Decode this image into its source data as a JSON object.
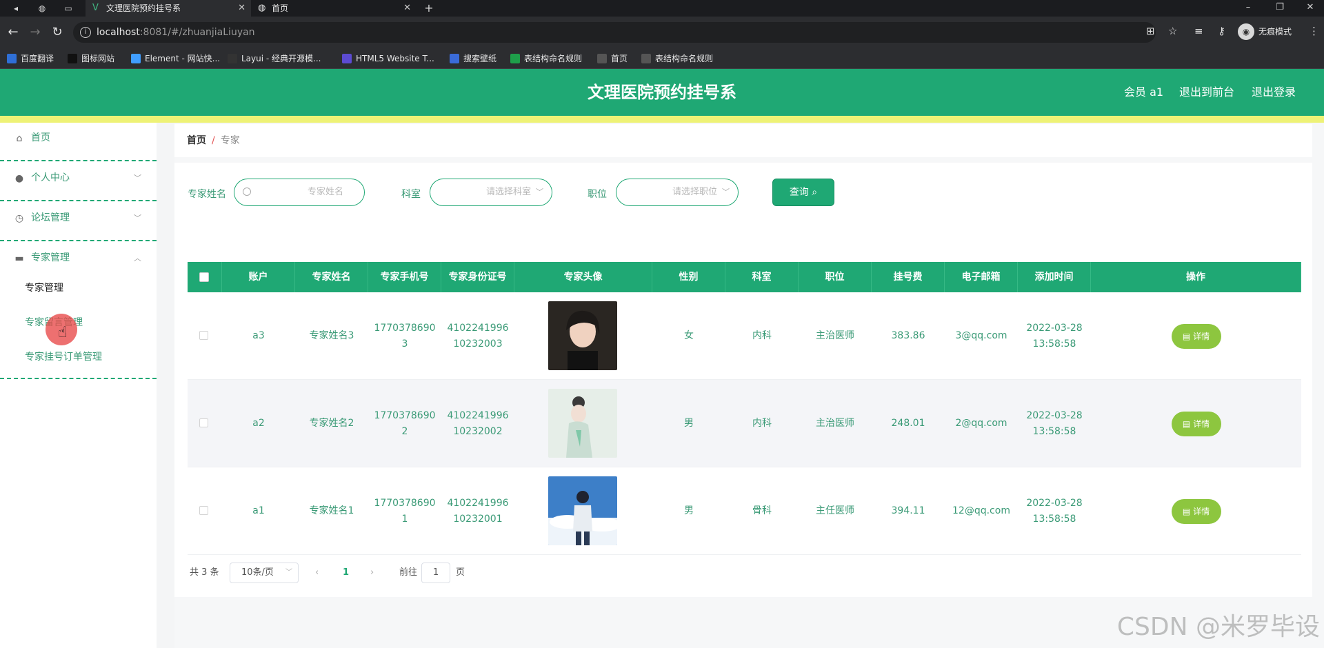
{
  "browser": {
    "tabs": [
      {
        "title": "文理医院预约挂号系",
        "active": true
      },
      {
        "title": "首页",
        "active": false
      }
    ],
    "url_host": "localhost",
    "url_rest": ":8081/#/zhuanjiaLiuyan",
    "incognito_label": "无痕模式",
    "bookmarks": [
      {
        "label": "百度翻译",
        "color": "#2f6fd6"
      },
      {
        "label": "图标网站",
        "color": "#111111"
      },
      {
        "label": "Element - 网站快...",
        "color": "#409eff"
      },
      {
        "label": "Layui - 经典开源模...",
        "color": "#333333"
      },
      {
        "label": "HTML5 Website T...",
        "color": "#5c4bd1"
      },
      {
        "label": "搜索壁纸",
        "color": "#3a6bd8"
      },
      {
        "label": "表结构命名规则",
        "color": "#1e9e4a"
      },
      {
        "label": "首页",
        "color": "#555555"
      },
      {
        "label": "表结构命名规则",
        "color": "#555555"
      }
    ]
  },
  "header": {
    "title": "文理医院预约挂号系",
    "member": "会员 a1",
    "to_front": "退出到前台",
    "logout": "退出登录",
    "colors": {
      "primary": "#1fa874",
      "accent_bar": "#eef276"
    }
  },
  "sidebar": {
    "items": [
      {
        "label": "首页",
        "icon": "home-icon"
      },
      {
        "label": "个人中心",
        "icon": "user-icon"
      },
      {
        "label": "论坛管理",
        "icon": "clock-icon"
      },
      {
        "label": "专家管理",
        "icon": "folder-icon"
      }
    ],
    "sub_items": [
      {
        "label": "专家管理",
        "active": true
      },
      {
        "label": "专家留言管理",
        "active": false
      },
      {
        "label": "专家挂号订单管理",
        "active": false
      }
    ]
  },
  "breadcrumb": {
    "home": "首页",
    "separator": "/",
    "current": "专家"
  },
  "search": {
    "name_label": "专家姓名",
    "name_placeholder": "专家姓名",
    "dept_label": "科室",
    "dept_placeholder": "请选择科室",
    "title_label": "职位",
    "title_placeholder": "请选择职位",
    "query_label": "查询"
  },
  "table": {
    "headers": [
      "账户",
      "专家姓名",
      "专家手机号",
      "专家身份证号",
      "专家头像",
      "性别",
      "科室",
      "职位",
      "挂号费",
      "电子邮箱",
      "添加时间",
      "操作"
    ],
    "rows": [
      {
        "account": "a3",
        "name": "专家姓名3",
        "phone_1": "1770378690",
        "phone_2": "3",
        "id_1": "4102241996",
        "id_2": "10232003",
        "gender": "女",
        "dept": "内科",
        "title": "主治医师",
        "fee": "383.86",
        "email": "3@qq.com",
        "date": "2022-03-28",
        "time": "13:58:58",
        "action": "详情"
      },
      {
        "account": "a2",
        "name": "专家姓名2",
        "phone_1": "1770378690",
        "phone_2": "2",
        "id_1": "4102241996",
        "id_2": "10232002",
        "gender": "男",
        "dept": "内科",
        "title": "主治医师",
        "fee": "248.01",
        "email": "2@qq.com",
        "date": "2022-03-28",
        "time": "13:58:58",
        "action": "详情"
      },
      {
        "account": "a1",
        "name": "专家姓名1",
        "phone_1": "1770378690",
        "phone_2": "1",
        "id_1": "4102241996",
        "id_2": "10232001",
        "gender": "男",
        "dept": "骨科",
        "title": "主任医师",
        "fee": "394.11",
        "email": "12@qq.com",
        "date": "2022-03-28",
        "time": "13:58:58",
        "action": "详情"
      }
    ]
  },
  "pagination": {
    "total": "共 3 条",
    "page_size": "10条/页",
    "current_page": "1",
    "goto_label": "前往",
    "goto_value": "1",
    "page_suffix": "页"
  },
  "watermark": "CSDN @米罗毕设"
}
